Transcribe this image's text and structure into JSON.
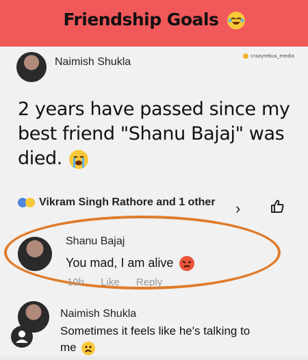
{
  "banner": {
    "title": "Friendship Goals"
  },
  "post": {
    "author": "Naimish Shukla",
    "watermark": "crazyrebus_media",
    "text": "2 years have passed since my best friend \"Shanu Bajaj\" was died."
  },
  "reactions": {
    "text": "Vikram Singh Rathore and 1 other"
  },
  "comments": [
    {
      "author": "Shanu Bajaj",
      "text": "You mad, I am alive",
      "time": "10h",
      "like": "Like",
      "reply": "Reply"
    },
    {
      "author": "Naimish Shukla",
      "text": "Sometimes it feels like he's talking to me"
    }
  ],
  "colors": {
    "banner": "#f0585a",
    "oval": "#e07b2a"
  }
}
